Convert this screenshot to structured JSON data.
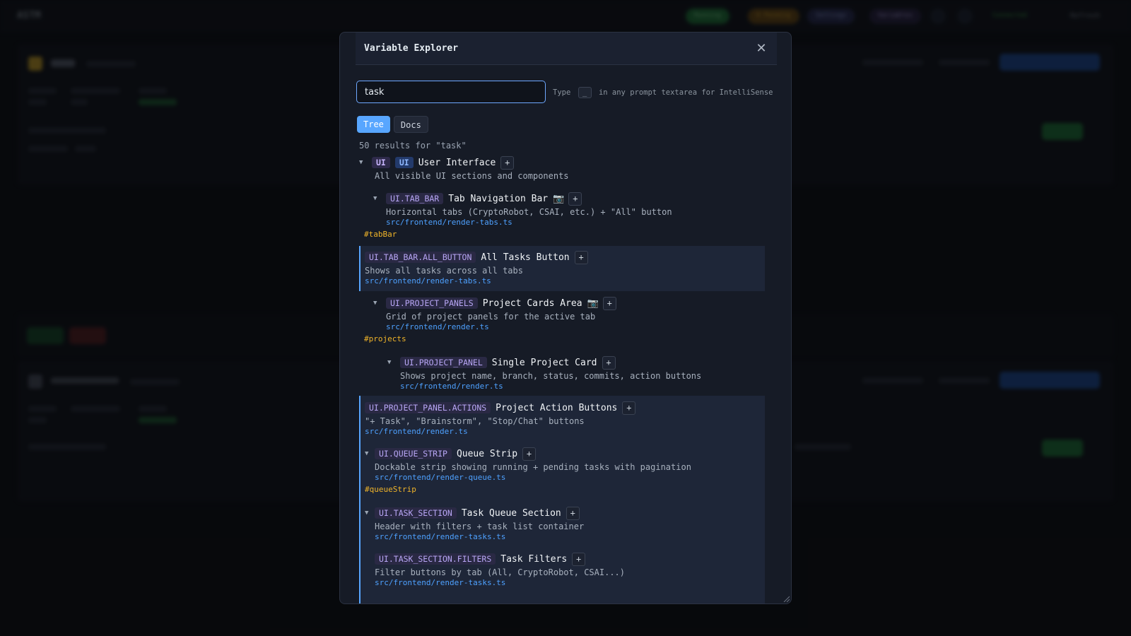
{
  "background": {
    "logo": "ASTM",
    "header_pills": [
      {
        "label": "Running",
        "color": "#1f7a3a"
      },
      {
        "label": "0 Pending",
        "color": "#6b4a12"
      },
      {
        "label": "Settings",
        "color": "#2a2e55"
      },
      {
        "label": "Variables",
        "color": "#2a2444"
      }
    ],
    "status_text": "Connected",
    "refresh_label": "Refresh"
  },
  "modal": {
    "title": "Variable Explorer",
    "close_icon": "close-icon",
    "search_value": "task",
    "hint_before": "Type",
    "hint_key": "_",
    "hint_after": "in any prompt textarea for IntelliSense",
    "tabs": [
      {
        "label": "Tree",
        "active": true
      },
      {
        "label": "Docs",
        "active": false
      }
    ],
    "results": "50 results for \"task\""
  },
  "tree": {
    "ui": {
      "key": "UI",
      "type": "UI",
      "label": "User Interface",
      "desc": "All visible UI sections and components",
      "plus": "+"
    },
    "tab_bar": {
      "key": "UI.TAB_BAR",
      "label": "Tab Navigation Bar",
      "desc": "Horizontal tabs (CryptoRobot, CSAI, etc.) + \"All\" button",
      "file": "src/frontend/render-tabs.ts",
      "anchor": "#tabBar",
      "plus": "+"
    },
    "all_button": {
      "key": "UI.TAB_BAR.ALL_BUTTON",
      "label": "All Tasks Button",
      "desc": "Shows all tasks across all tabs",
      "file": "src/frontend/render-tabs.ts",
      "plus": "+"
    },
    "project_panels": {
      "key": "UI.PROJECT_PANELS",
      "label": "Project Cards Area",
      "desc": "Grid of project panels for the active tab",
      "file": "src/frontend/render.ts",
      "anchor": "#projects",
      "plus": "+"
    },
    "project_panel": {
      "key": "UI.PROJECT_PANEL",
      "label": "Single Project Card",
      "desc": "Shows project name, branch, status, commits, action buttons",
      "file": "src/frontend/render.ts",
      "plus": "+"
    },
    "panel_actions": {
      "key": "UI.PROJECT_PANEL.ACTIONS",
      "label": "Project Action Buttons",
      "desc": "\"+ Task\", \"Brainstorm\", \"Stop/Chat\" buttons",
      "file": "src/frontend/render.ts",
      "plus": "+"
    },
    "queue_strip": {
      "key": "UI.QUEUE_STRIP",
      "label": "Queue Strip",
      "desc": "Dockable strip showing running + pending tasks with pagination",
      "file": "src/frontend/render-queue.ts",
      "anchor": "#queueStrip",
      "plus": "+"
    },
    "task_section": {
      "key": "UI.TASK_SECTION",
      "label": "Task Queue Section",
      "desc": "Header with filters + task list container",
      "file": "src/frontend/render-tasks.ts",
      "plus": "+"
    },
    "task_filters": {
      "key": "UI.TASK_SECTION.FILTERS",
      "label": "Task Filters",
      "desc": "Filter buttons by tab (All, CryptoRobot, CSAI...)",
      "file": "src/frontend/render-tasks.ts",
      "plus": "+"
    }
  }
}
